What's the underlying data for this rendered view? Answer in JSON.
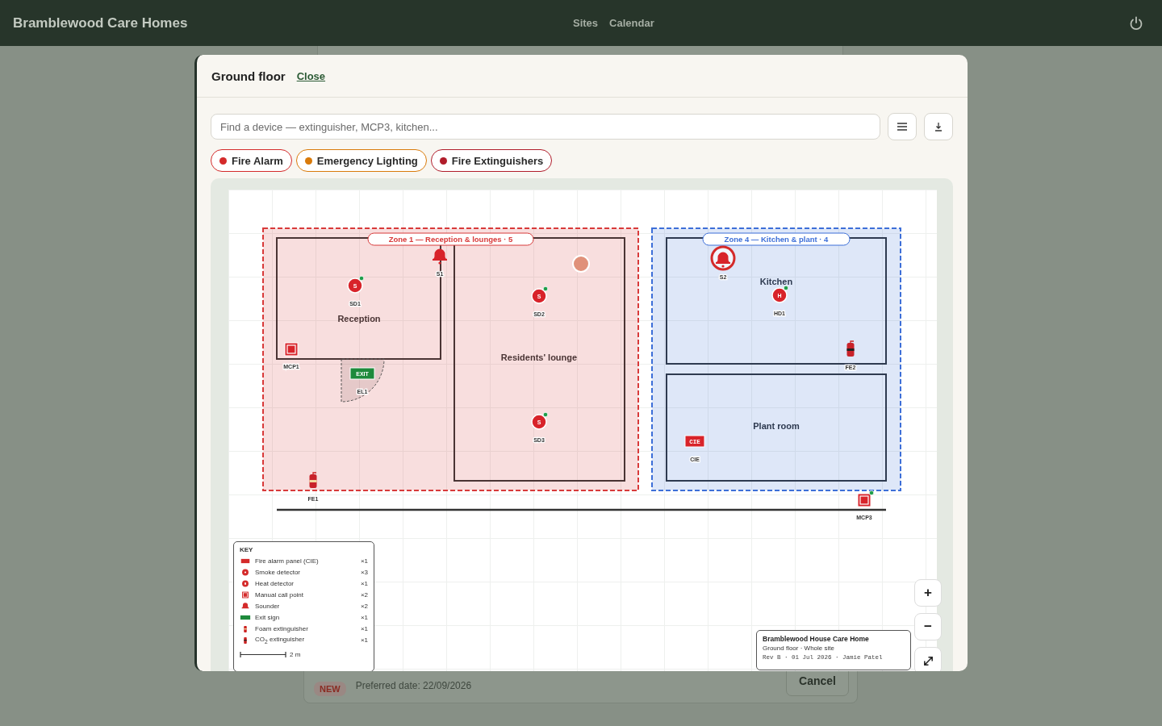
{
  "app": {
    "title": "Bramblewood Care Homes",
    "nav": [
      {
        "label": "Sites"
      },
      {
        "label": "Calendar"
      }
    ]
  },
  "background": {
    "request": {
      "badge": "NEW",
      "preferred": "Preferred date: 22/09/2026",
      "cancel": "Cancel"
    }
  },
  "dialog": {
    "title": "Ground floor",
    "close": "Close",
    "search": {
      "placeholder": "Find a device — extinguisher, MCP3, kitchen..."
    },
    "layers": [
      {
        "label": "Fire Alarm",
        "color": "#d42a2a"
      },
      {
        "label": "Emergency Lighting",
        "color": "#d97a0a"
      },
      {
        "label": "Fire Extinguishers",
        "color": "#b01c2a"
      }
    ],
    "plan": {
      "zones": [
        {
          "label": "Zone 1 — Reception & lounges · 5",
          "color": "#d83a3a",
          "rooms": [
            {
              "name": "Reception"
            },
            {
              "name": "Residents' lounge"
            }
          ]
        },
        {
          "label": "Zone 4 — Kitchen & plant · 4",
          "color": "#3d6fd8",
          "rooms": [
            {
              "name": "Kitchen"
            },
            {
              "name": "Plant room"
            }
          ]
        }
      ],
      "devices": [
        {
          "kind": "smoke",
          "label": "SD1",
          "glyph": "S",
          "online": true,
          "selected": false
        },
        {
          "kind": "smoke",
          "label": "SD2",
          "glyph": "S",
          "online": true,
          "selected": false
        },
        {
          "kind": "smoke",
          "label": "SD3",
          "glyph": "S",
          "online": true,
          "selected": false
        },
        {
          "kind": "sounder",
          "label": "S1",
          "online": false,
          "selected": false
        },
        {
          "kind": "mcp",
          "label": "MCP1",
          "online": false,
          "selected": false
        },
        {
          "kind": "exit",
          "label": "EL1",
          "glyph": "EXIT",
          "online": false,
          "selected": false
        },
        {
          "kind": "extinguisher",
          "label": "FE1",
          "online": false,
          "selected": false
        },
        {
          "kind": "sounder",
          "label": "S2",
          "online": false,
          "selected": true
        },
        {
          "kind": "heat",
          "label": "HD1",
          "glyph": "H",
          "online": true,
          "selected": false
        },
        {
          "kind": "extinguisher",
          "label": "FE2",
          "online": false,
          "selected": false
        },
        {
          "kind": "cie",
          "label": "CIE",
          "glyph": "CIE",
          "online": false,
          "selected": false
        },
        {
          "kind": "mcp",
          "label": "MCP3",
          "online": true,
          "selected": false
        }
      ],
      "legend": {
        "title": "KEY",
        "items": [
          {
            "kind": "cie",
            "label": "Fire alarm panel (CIE)",
            "count": "×1"
          },
          {
            "kind": "smoke",
            "label": "Smoke detector",
            "count": "×3"
          },
          {
            "kind": "heat",
            "label": "Heat detector",
            "count": "×1"
          },
          {
            "kind": "mcp",
            "label": "Manual call point",
            "count": "×2"
          },
          {
            "kind": "sounder",
            "label": "Sounder",
            "count": "×2"
          },
          {
            "kind": "exit",
            "label": "Exit sign",
            "count": "×1"
          },
          {
            "kind": "foam",
            "label": "Foam extinguisher",
            "count": "×1"
          },
          {
            "kind": "co2",
            "label": "CO$_{2}$ extinguisher",
            "count": "×1"
          }
        ],
        "scale": "2 m"
      },
      "title_block": {
        "name": "Bramblewood House Care Home",
        "subtitle": "Ground floor · Whole site",
        "revision": "Rev B · 01 Jul 2026 · Jamie Patel"
      },
      "zoom": {
        "in": "+",
        "out": "−"
      }
    }
  }
}
